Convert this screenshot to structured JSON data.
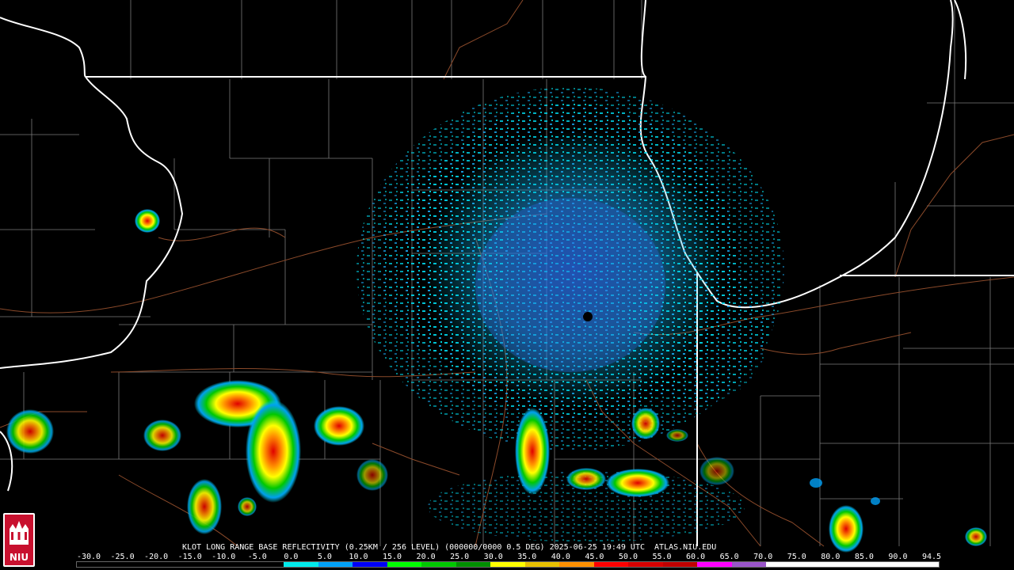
{
  "product": {
    "caption": "KLOT LONG RANGE BASE REFLECTIVITY (0.25KM / 256 LEVEL) (000000/0000 0.5 DEG) 2025-06-25 19:49 UTC  ATLAS.NIU.EDU",
    "radar_site": "KLOT",
    "timestamp": "2025-06-25 19:49 UTC",
    "source": "ATLAS.NIU.EDU"
  },
  "logo": {
    "text": "NIU",
    "color": "#c8102e"
  },
  "scale": {
    "labels": [
      "-30.0",
      "-25.0",
      "-20.0",
      "-15.0",
      "-10.0",
      "-5.0",
      "0.0",
      "5.0",
      "10.0",
      "15.0",
      "20.0",
      "25.0",
      "30.0",
      "35.0",
      "40.0",
      "45.0",
      "50.0",
      "55.0",
      "60.0",
      "65.0",
      "70.0",
      "75.0",
      "80.0",
      "85.0",
      "90.0",
      "94.5"
    ],
    "colors": [
      "#000000",
      "#000000",
      "#000000",
      "#000000",
      "#000000",
      "#000000",
      "#00eaec",
      "#01a0f6",
      "#0000f6",
      "#00ff00",
      "#00c800",
      "#009000",
      "#ffff00",
      "#e7c000",
      "#ff9000",
      "#ff0000",
      "#d60000",
      "#c00000",
      "#ff00ff",
      "#9955c9",
      "#ffffff",
      "#ffffff",
      "#ffffff",
      "#ffffff",
      "#ffffff"
    ]
  },
  "map_features": {
    "state_border_color": "#ffffff",
    "county_line_color": "#888888",
    "road_color": "#8b4a2a",
    "radar_site_marker": "radar-site-dot"
  }
}
